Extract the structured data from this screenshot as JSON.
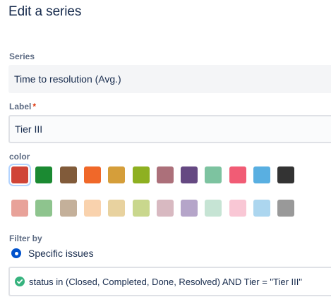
{
  "dialog": {
    "title": "Edit a series"
  },
  "series": {
    "label": "Series",
    "value": "Time to resolution (Avg.)"
  },
  "label_field": {
    "label": "Label",
    "required_marker": "*",
    "value": "Tier III"
  },
  "color": {
    "label": "color",
    "selected_index": 0,
    "row1": [
      "#d04437",
      "#1b8a32",
      "#815b3a",
      "#f06829",
      "#d59e3a",
      "#8eb021",
      "#ac707a",
      "#654982",
      "#7dc3a0",
      "#f15c75",
      "#59afe1",
      "#333333"
    ],
    "row2": [
      "#e8a299",
      "#8ec48e",
      "#c4b09a",
      "#f9d2ad",
      "#e8d29f",
      "#c9d78d",
      "#d8b9c1",
      "#b5a5c9",
      "#c6e4d4",
      "#f9c7d5",
      "#acd6ef",
      "#999999"
    ]
  },
  "filter": {
    "label": "Filter by",
    "option_label": "Specific issues",
    "query": "status in (Closed, Completed, Done, Resolved) AND Tier = \"Tier III\""
  },
  "icons": {
    "radio": "radio-selected-icon",
    "check": "check-circle-icon"
  },
  "colors": {
    "success_green": "#36b37e",
    "radio_blue": "#0052cc",
    "required_red": "#de350b"
  }
}
